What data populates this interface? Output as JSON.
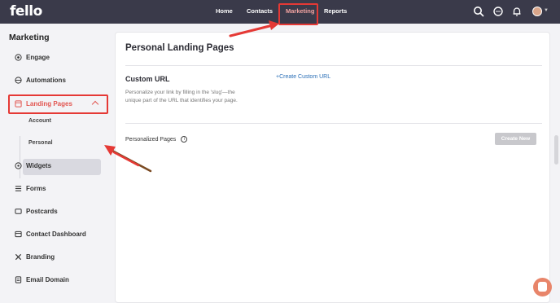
{
  "brand": {
    "logo": "fello"
  },
  "topnav": {
    "items": [
      {
        "label": "Home"
      },
      {
        "label": "Contacts"
      },
      {
        "label": "Marketing"
      },
      {
        "label": "Reports"
      }
    ],
    "active": "Marketing",
    "icons": [
      "search-icon",
      "chat-icon",
      "bell-icon",
      "avatar"
    ]
  },
  "sidebar": {
    "title": "Marketing",
    "items": [
      {
        "label": "Engage",
        "icon": "engage-icon"
      },
      {
        "label": "Automations",
        "icon": "automations-icon"
      },
      {
        "label": "Landing Pages",
        "icon": "landing-pages-icon"
      },
      {
        "label": "Widgets",
        "icon": "widgets-icon"
      },
      {
        "label": "Forms",
        "icon": "forms-icon"
      },
      {
        "label": "Postcards",
        "icon": "postcards-icon"
      },
      {
        "label": "Contact Dashboard",
        "icon": "contact-dashboard-icon"
      },
      {
        "label": "Branding",
        "icon": "branding-icon"
      },
      {
        "label": "Email Domain",
        "icon": "email-domain-icon"
      }
    ],
    "subitems": [
      {
        "label": "Account"
      },
      {
        "label": "Personal"
      }
    ],
    "active_subitem": "Personal"
  },
  "main": {
    "title": "Personal Landing Pages",
    "custom_url": {
      "title": "Custom URL",
      "description": "Personalize your link by filling in the 'slug'—the unique part of the URL that identifies your page.",
      "link": "+Create Custom URL"
    },
    "personalized_pages": {
      "label": "Personalized Pages",
      "button": "Create New"
    }
  },
  "colors": {
    "topbar": "#3a3a4a",
    "active_nav": "#f0a2a0",
    "accent_red": "#e25550",
    "link_blue": "#2a6fb7",
    "annotation_red": "#e53935"
  }
}
